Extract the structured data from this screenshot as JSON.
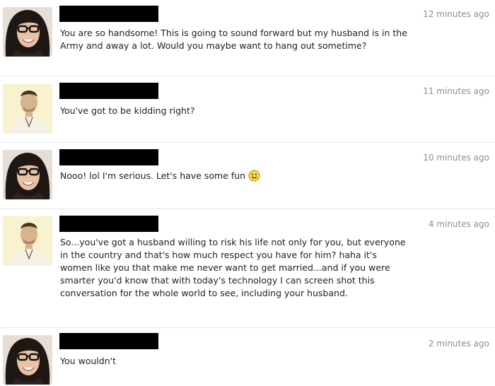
{
  "messages": [
    {
      "sender": "woman",
      "avatar_icon": "woman-with-glasses-avatar",
      "name_redacted": true,
      "timestamp": "12 minutes ago",
      "text": "You are so handsome! This is going to sound forward but my husband is in the Army and away a lot. Would you maybe want to hang out sometime?"
    },
    {
      "sender": "man",
      "avatar_icon": "man-avatar",
      "name_redacted": true,
      "timestamp": "11 minutes ago",
      "text": "You've got to be kidding right?"
    },
    {
      "sender": "woman",
      "avatar_icon": "woman-with-glasses-avatar",
      "name_redacted": true,
      "timestamp": "10 minutes ago",
      "text": "Nooo! lol I'm serious. Let's have some fun",
      "emoji": "smiley-emoji"
    },
    {
      "sender": "man",
      "avatar_icon": "man-avatar",
      "name_redacted": true,
      "timestamp": "4 minutes ago",
      "text": "So...you've got a husband willing to risk his life not only for you, but everyone in the country and that's how much respect you have for him? haha it's women like you that make me never want to get married...and if you were smarter you'd know that with today's technology I can screen shot this conversation for the whole world to see, including your husband."
    },
    {
      "sender": "woman",
      "avatar_icon": "woman-with-glasses-avatar",
      "name_redacted": true,
      "timestamp": "2 minutes ago",
      "text": "You wouldn't"
    }
  ],
  "colors": {
    "timestamp": "#8a8f98",
    "divider": "#e3e6ec",
    "redaction": "#000000",
    "emoji_fill": "#f7d84a"
  }
}
